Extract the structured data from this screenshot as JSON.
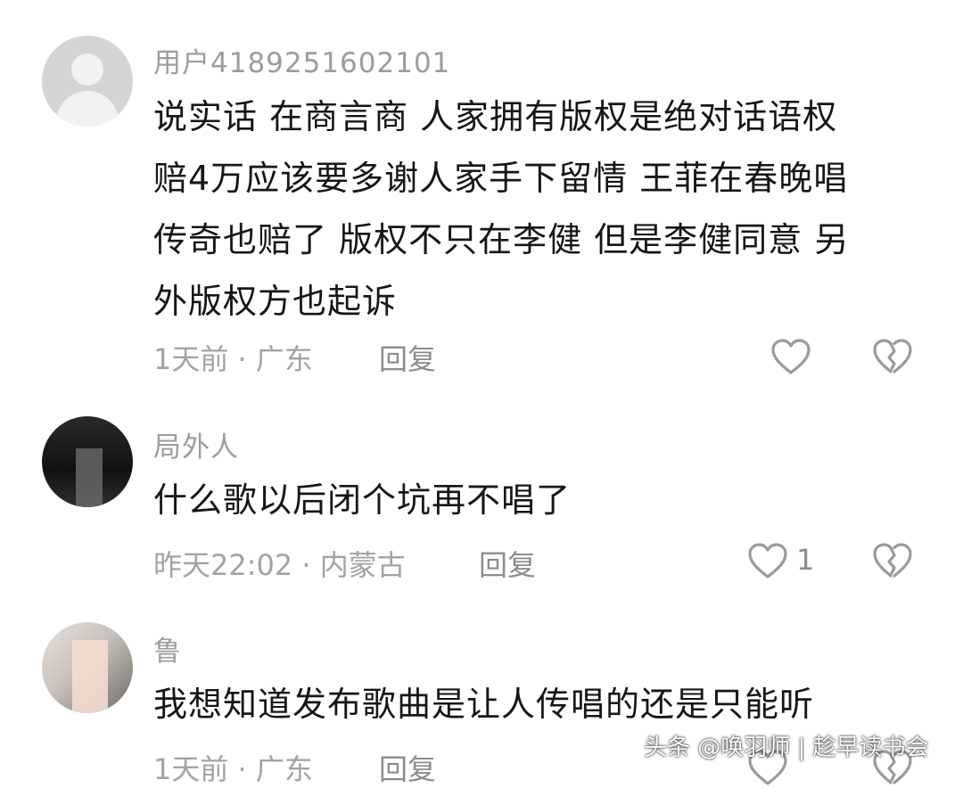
{
  "comments": [
    {
      "username": "用户4189251602101",
      "avatar": "default-avatar",
      "text": "说实话 在商言商 人家拥有版权是绝对话语权\n赔4万应该要多谢人家手下留情 王菲在春晚唱\n传奇也赔了 版权不只在李健 但是李健同意 另\n外版权方也起诉",
      "meta": "1天前 · 广东",
      "reply_label": "回复",
      "likes": "",
      "like_icon": "heart-outline-icon",
      "dislike_icon": "broken-heart-icon"
    },
    {
      "username": "局外人",
      "avatar": "dark-avatar",
      "text": "什么歌以后闭个坑再不唱了",
      "meta": "昨天22:02 · 内蒙古",
      "reply_label": "回复",
      "likes": "1",
      "like_icon": "heart-outline-icon",
      "dislike_icon": "broken-heart-icon"
    },
    {
      "username": "鲁",
      "avatar": "photo-avatar",
      "text": "我想知道发布歌曲是让人传唱的还是只能听",
      "meta": "1天前 · 广东",
      "reply_label": "回复",
      "likes": "",
      "like_icon": "heart-outline-icon",
      "dislike_icon": "broken-heart-icon"
    }
  ],
  "watermark": "头条 @唤羽师 | 趁早读书会",
  "colors": {
    "username": "#9c9c9c",
    "text": "#161616",
    "meta": "#a3a3a3",
    "icon": "#9a9a9a"
  }
}
